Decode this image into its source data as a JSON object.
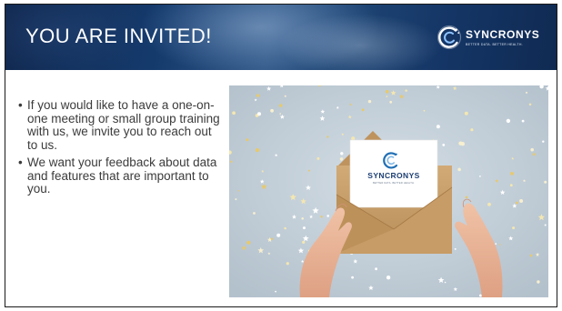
{
  "slide": {
    "title": "YOU ARE INVITED!",
    "logo": {
      "name": "SYNCRONYS",
      "tagline": "BETTER DATA. BETTER HEALTH."
    },
    "bullets": [
      {
        "marker": "•",
        "text": "If you would like to have a one-on-one meeting or small group training with us, we invite you to reach out to us."
      },
      {
        "marker": "•",
        "text": "We want your feedback about data and features that are important to you."
      }
    ],
    "photo": {
      "card_logo_name": "SYNCRONYS",
      "card_logo_tagline": "BETTER DATA. BETTER HEALTH."
    }
  },
  "colors": {
    "header_dark": "#10284f",
    "header_mid": "#2f5685",
    "title_text": "#ffffff",
    "body_text": "#3b3b3b",
    "photo_background": "#c3cfd8",
    "envelope": "#c9a06a",
    "card": "#ffffff",
    "logo_accent": "#1f6fb5"
  },
  "icons": {
    "logo": "syncronys-swirl-icon"
  }
}
